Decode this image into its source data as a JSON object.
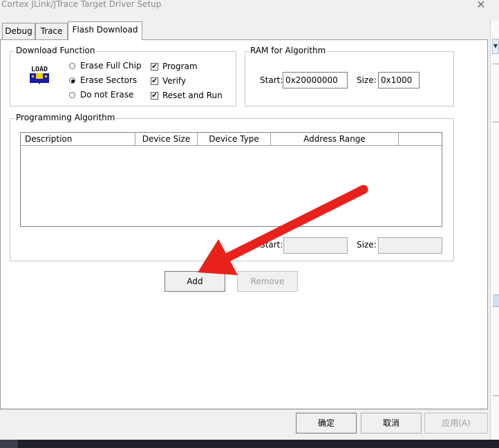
{
  "window": {
    "title": "Cortex JLink/JTrace Target Driver Setup",
    "close_glyph": "✕"
  },
  "tabs": [
    {
      "label": "Debug"
    },
    {
      "label": "Trace"
    },
    {
      "label": "Flash Download"
    }
  ],
  "download_function": {
    "legend": "Download Function",
    "icon_text": "LOAD",
    "erase_options": [
      {
        "label": "Erase Full Chip",
        "selected": false
      },
      {
        "label": "Erase Sectors",
        "selected": true
      },
      {
        "label": "Do not Erase",
        "selected": false
      }
    ],
    "checks": [
      {
        "label": "Program",
        "checked": true
      },
      {
        "label": "Verify",
        "checked": true
      },
      {
        "label": "Reset and Run",
        "checked": true
      }
    ]
  },
  "ram": {
    "legend": "RAM for Algorithm",
    "start_label": "Start:",
    "start_value": "0x20000000",
    "size_label": "Size:",
    "size_value": "0x1000"
  },
  "programming_algorithm": {
    "legend": "Programming Algorithm",
    "columns": [
      "Description",
      "Device Size",
      "Device Type",
      "Address Range"
    ],
    "start_label": "Start:",
    "start_value": "",
    "size_label": "Size:",
    "size_value": ""
  },
  "actions": {
    "add": "Add",
    "remove": "Remove"
  },
  "dialog_buttons": {
    "ok": "确定",
    "cancel": "取消",
    "apply": "应用(A)"
  },
  "annotation": {
    "arrow_color": "#e8221b"
  }
}
